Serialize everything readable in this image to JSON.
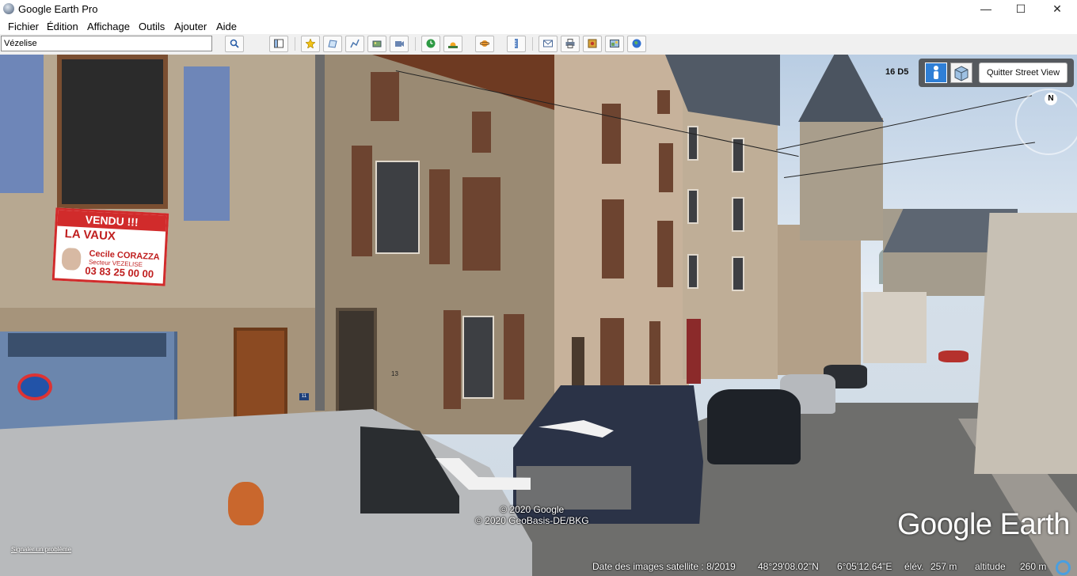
{
  "window": {
    "title": "Google Earth Pro",
    "min_label": "—",
    "max_label": "☐",
    "close_label": "✕"
  },
  "menu": {
    "items": [
      "Fichier",
      "Édition",
      "Affichage",
      "Outils",
      "Ajouter",
      "Aide"
    ]
  },
  "toolbar": {
    "search_value": "Vézelise",
    "buttons": [
      "search-icon",
      "sidebar-toggle-icon",
      "add-placemark-icon",
      "add-polygon-icon",
      "add-path-icon",
      "add-image-overlay-icon",
      "record-tour-icon",
      "historical-imagery-icon",
      "sunlight-icon",
      "planets-icon",
      "ruler-icon",
      "email-icon",
      "print-icon",
      "save-image-icon",
      "view-in-maps-icon",
      "earth-icon"
    ]
  },
  "streetview": {
    "imagery_code": "16 D5",
    "exit_label": "Quitter Street View",
    "compass_label": "N",
    "copyright_lines": [
      "© 2020 Google",
      "© 2020 GeoBasis-DE/BKG"
    ],
    "logo_text": "Google Earth",
    "report_link": "Signaler un problème",
    "scene_text": {
      "sign_vendu": "VENDU !!!",
      "sign_brand": "LA VAUX",
      "sign_name": "Cecile CORAZZA",
      "sign_sub": "Secteur VEZELISE",
      "sign_phone": "03 83 25 00 00",
      "house_number": "13",
      "door_number": "11"
    }
  },
  "status": {
    "imagery_date": "Date des images satellite : 8/2019",
    "latitude": "48°29'08.02\"N",
    "longitude": "6°05'12.64\"E",
    "elevation_label": "élév.",
    "elevation_value": "257 m",
    "altitude_label": "altitude",
    "altitude_value": "260 m"
  },
  "colors": {
    "toolbar_bg": "#f0f0f0",
    "pegman_active": "#2f7fd6",
    "status_ring": "#4a9fe0"
  }
}
